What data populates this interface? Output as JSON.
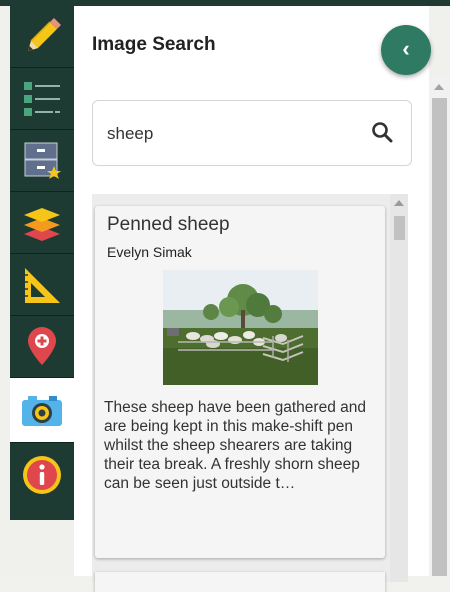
{
  "toolbar": {
    "tools": [
      {
        "icon": "pencil-icon"
      },
      {
        "icon": "legend-list-icon"
      },
      {
        "icon": "saved-maps-icon"
      },
      {
        "icon": "layers-icon"
      },
      {
        "icon": "measure-ruler-icon"
      },
      {
        "icon": "location-pin-icon"
      },
      {
        "icon": "camera-icon",
        "active": true
      },
      {
        "icon": "info-icon"
      }
    ]
  },
  "panel": {
    "title": "Image Search",
    "collapse_icon": "chevron-left-icon"
  },
  "search": {
    "value": "sheep",
    "icon": "search-icon"
  },
  "results": [
    {
      "title": "Penned sheep",
      "author": "Evelyn Simak",
      "description": "These sheep have been gathered and are being kept in this make-shift pen whilst the sheep shearers are taking their tea break. A freshly shorn sheep can be seen just outside t…"
    }
  ],
  "colors": {
    "toolbar_bg": "#1e3b33",
    "accent": "#2f7a63",
    "panel_bg": "#ffffff"
  }
}
